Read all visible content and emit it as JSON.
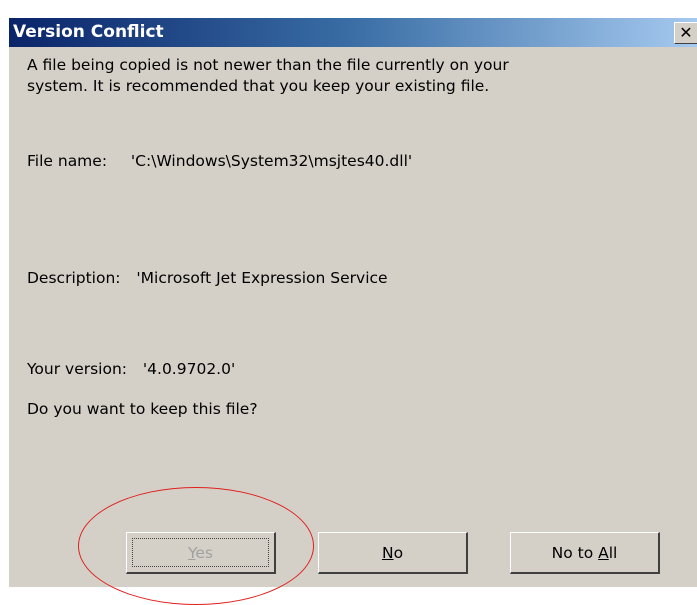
{
  "dialog": {
    "title": "Version Conflict",
    "close_glyph": "✕",
    "message": [
      "A file being copied is not newer than the file currently on your",
      "system. It is recommended that you keep your existing file."
    ],
    "file_name_label": "File name:",
    "file_name_value": "'C:\\Windows\\System32\\msjtes40.dll'",
    "description_label": "Description:",
    "description_value": "'Microsoft Jet Expression Service",
    "version_label": "Your version:",
    "version_value": "'4.0.9702.0'",
    "question": "Do you want to keep this file?"
  },
  "buttons": {
    "yes": {
      "mnemonic": "Y",
      "rest": "es",
      "enabled": false
    },
    "no": {
      "mnemonic": "N",
      "rest": "o"
    },
    "no_to_all": {
      "prefix": "No to ",
      "mnemonic": "A",
      "rest": "ll"
    }
  },
  "annotation": {
    "color": "#e0201c",
    "shape": "ellipse"
  },
  "colors": {
    "title_gradient_start": "#0a246a",
    "title_gradient_end": "#a6caf0",
    "dialog_background": "#d4d0c8"
  }
}
